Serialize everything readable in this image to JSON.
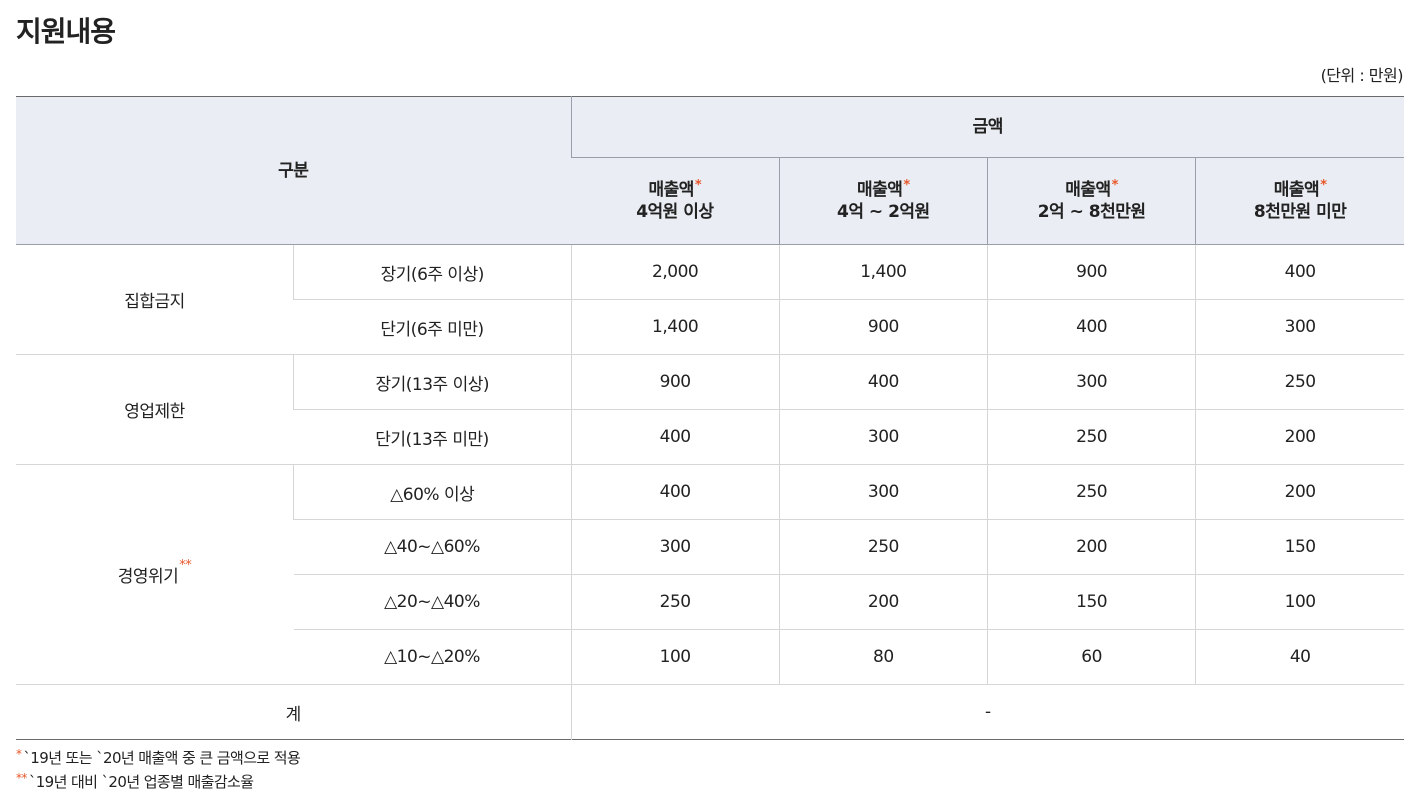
{
  "page": {
    "title": "지원내용",
    "unit": "(단위 : 만원)"
  },
  "table": {
    "header": {
      "category": "구분",
      "amount": "금액",
      "columns": [
        {
          "line1": "매출액",
          "mark": "*",
          "line2": "4억원 이상"
        },
        {
          "line1": "매출액",
          "mark": "*",
          "line2": "4억 ~ 2억원"
        },
        {
          "line1": "매출액",
          "mark": "*",
          "line2": "2억 ~ 8천만원"
        },
        {
          "line1": "매출액",
          "mark": "*",
          "line2": "8천만원 미만"
        }
      ]
    },
    "groups": [
      {
        "label": "집합금지",
        "mark": "",
        "rows": [
          {
            "sub": "장기(6주 이상)",
            "values": [
              "2,000",
              "1,400",
              "900",
              "400"
            ]
          },
          {
            "sub": "단기(6주 미만)",
            "values": [
              "1,400",
              "900",
              "400",
              "300"
            ]
          }
        ]
      },
      {
        "label": "영업제한",
        "mark": "",
        "rows": [
          {
            "sub": "장기(13주 이상)",
            "values": [
              "900",
              "400",
              "300",
              "250"
            ]
          },
          {
            "sub": "단기(13주 미만)",
            "values": [
              "400",
              "300",
              "250",
              "200"
            ]
          }
        ]
      },
      {
        "label": "경영위기",
        "mark": "**",
        "rows": [
          {
            "sub": "△60% 이상",
            "values": [
              "400",
              "300",
              "250",
              "200"
            ]
          },
          {
            "sub": "△40~△60%",
            "values": [
              "300",
              "250",
              "200",
              "150"
            ]
          },
          {
            "sub": "△20~△40%",
            "values": [
              "250",
              "200",
              "150",
              "100"
            ]
          },
          {
            "sub": "△10~△20%",
            "values": [
              "100",
              "80",
              "60",
              "40"
            ]
          }
        ]
      }
    ],
    "total": {
      "label": "계",
      "value": "-"
    }
  },
  "notes": [
    {
      "mark": "*",
      "text": "`19년 또는 `20년 매출액 중 큰 금액으로 적용"
    },
    {
      "mark": "**",
      "text": "`19년 대비 `20년 업종별 매출감소율"
    }
  ],
  "colors": {
    "accent_mark": "#e8572a",
    "header_bg": "#eaedf3"
  }
}
